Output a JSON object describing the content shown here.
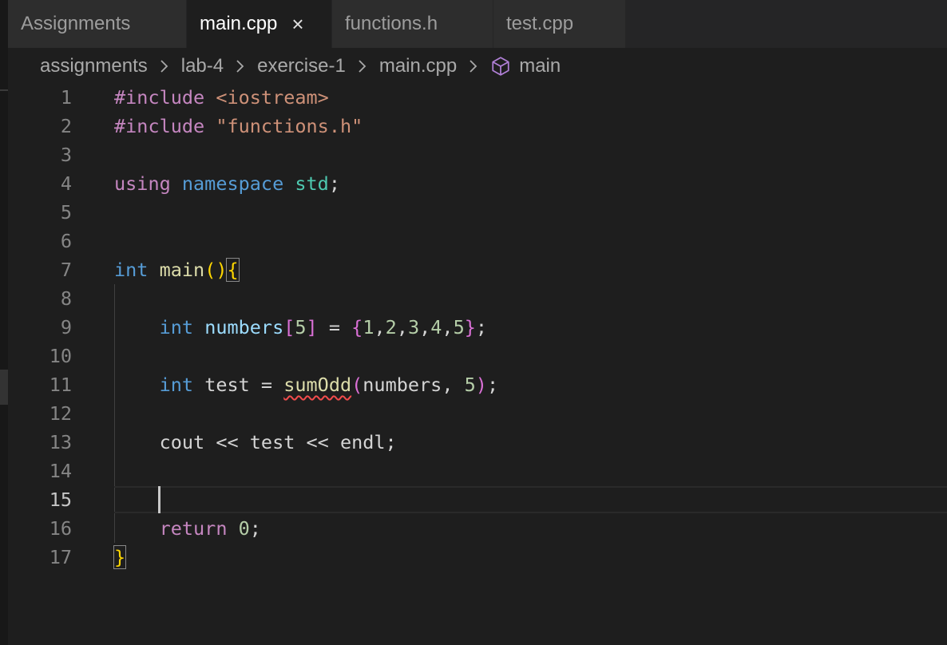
{
  "tabs": [
    {
      "label": "Assignments",
      "active": false
    },
    {
      "label": "main.cpp",
      "active": true,
      "close_icon": "×"
    },
    {
      "label": "functions.h",
      "active": false
    },
    {
      "label": "test.cpp",
      "active": false
    }
  ],
  "breadcrumb": {
    "items": [
      "assignments",
      "lab-4",
      "exercise-1",
      "main.cpp"
    ],
    "symbol": {
      "icon": "cube-icon",
      "label": "main"
    },
    "separator_icon": "chevron-right-icon"
  },
  "editor": {
    "current_line": 15,
    "lines": [
      {
        "n": "1",
        "tokens": [
          {
            "t": "#include ",
            "c": "kw-pp"
          },
          {
            "t": "<iostream>",
            "c": "str"
          }
        ]
      },
      {
        "n": "2",
        "tokens": [
          {
            "t": "#include ",
            "c": "kw-pp"
          },
          {
            "t": "\"functions.h\"",
            "c": "str"
          }
        ]
      },
      {
        "n": "3",
        "tokens": []
      },
      {
        "n": "4",
        "tokens": [
          {
            "t": "using ",
            "c": "kw-ctl"
          },
          {
            "t": "namespace ",
            "c": "kw"
          },
          {
            "t": "std",
            "c": "ns"
          },
          {
            "t": ";",
            "c": "plain"
          }
        ]
      },
      {
        "n": "5",
        "tokens": []
      },
      {
        "n": "6",
        "tokens": []
      },
      {
        "n": "7",
        "tokens": [
          {
            "t": "int ",
            "c": "kw"
          },
          {
            "t": "main",
            "c": "fn"
          },
          {
            "t": "()",
            "c": "br1"
          },
          {
            "t": "{",
            "c": "br1 bracket-match"
          }
        ]
      },
      {
        "n": "8",
        "tokens": []
      },
      {
        "n": "9",
        "tokens": [
          {
            "t": "    ",
            "c": "plain"
          },
          {
            "t": "int ",
            "c": "kw"
          },
          {
            "t": "numbers",
            "c": "var"
          },
          {
            "t": "[",
            "c": "br2"
          },
          {
            "t": "5",
            "c": "num"
          },
          {
            "t": "]",
            "c": "br2"
          },
          {
            "t": " = ",
            "c": "plain"
          },
          {
            "t": "{",
            "c": "br2"
          },
          {
            "t": "1",
            "c": "num"
          },
          {
            "t": ",",
            "c": "plain"
          },
          {
            "t": "2",
            "c": "num"
          },
          {
            "t": ",",
            "c": "plain"
          },
          {
            "t": "3",
            "c": "num"
          },
          {
            "t": ",",
            "c": "plain"
          },
          {
            "t": "4",
            "c": "num"
          },
          {
            "t": ",",
            "c": "plain"
          },
          {
            "t": "5",
            "c": "num"
          },
          {
            "t": "}",
            "c": "br2"
          },
          {
            "t": ";",
            "c": "plain"
          }
        ]
      },
      {
        "n": "10",
        "tokens": []
      },
      {
        "n": "11",
        "tokens": [
          {
            "t": "    ",
            "c": "plain"
          },
          {
            "t": "int ",
            "c": "kw"
          },
          {
            "t": "test",
            "c": "plain"
          },
          {
            "t": " = ",
            "c": "plain"
          },
          {
            "t": "sumOdd",
            "c": "fn squiggle"
          },
          {
            "t": "(",
            "c": "br2"
          },
          {
            "t": "numbers",
            "c": "plain"
          },
          {
            "t": ", ",
            "c": "plain"
          },
          {
            "t": "5",
            "c": "num"
          },
          {
            "t": ")",
            "c": "br2"
          },
          {
            "t": ";",
            "c": "plain"
          }
        ]
      },
      {
        "n": "12",
        "tokens": []
      },
      {
        "n": "13",
        "tokens": [
          {
            "t": "    cout << test << endl;",
            "c": "plain"
          }
        ]
      },
      {
        "n": "14",
        "tokens": []
      },
      {
        "n": "15",
        "tokens": []
      },
      {
        "n": "16",
        "tokens": [
          {
            "t": "    ",
            "c": "plain"
          },
          {
            "t": "return ",
            "c": "kw-ctl"
          },
          {
            "t": "0",
            "c": "num"
          },
          {
            "t": ";",
            "c": "plain"
          }
        ]
      },
      {
        "n": "17",
        "tokens": [
          {
            "t": "}",
            "c": "br1 bracket-match"
          }
        ]
      }
    ]
  },
  "diagnostics": [
    {
      "line": 11,
      "symbol": "sumOdd",
      "severity": "error"
    }
  ]
}
